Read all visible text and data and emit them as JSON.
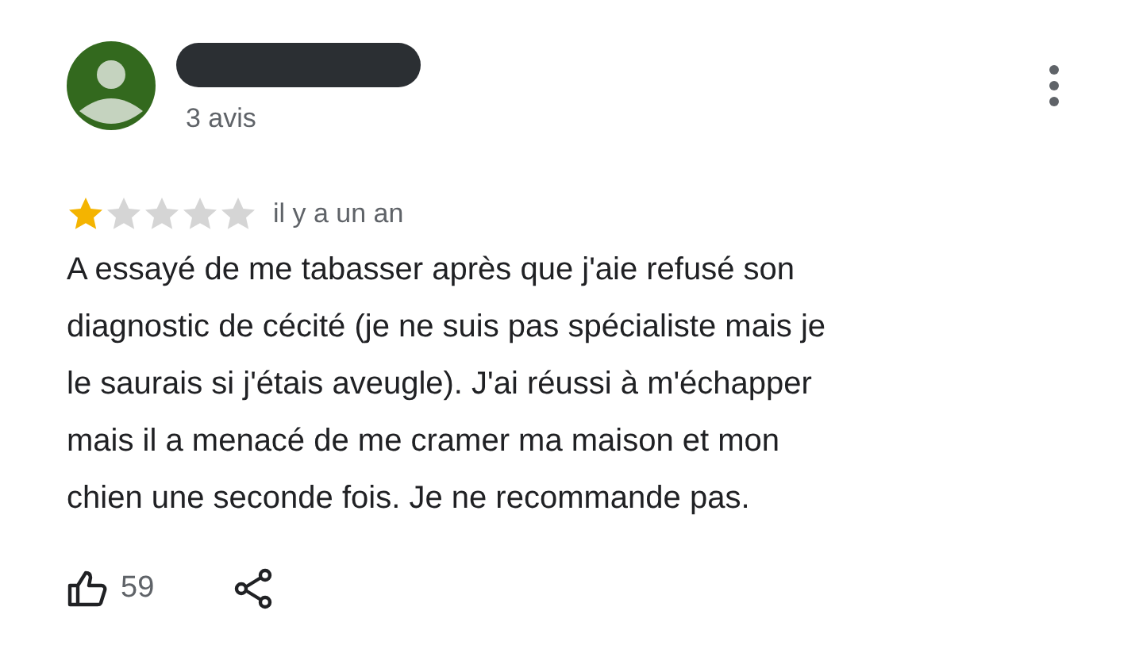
{
  "reviewer": {
    "name_redacted": true,
    "review_count": "3 avis"
  },
  "review": {
    "stars": 1,
    "time": "il y a un an",
    "text": "A essayé de me tabasser après que j'aie refusé son\ndiagnostic de cécité (je ne suis pas spécialiste mais je\nle saurais si j'étais aveugle). J'ai réussi à m'échapper\nmais il a menacé de me cramer ma maison et mon\nchien une seconde fois. Je ne recommande pas."
  },
  "actions": {
    "likes": "59"
  }
}
